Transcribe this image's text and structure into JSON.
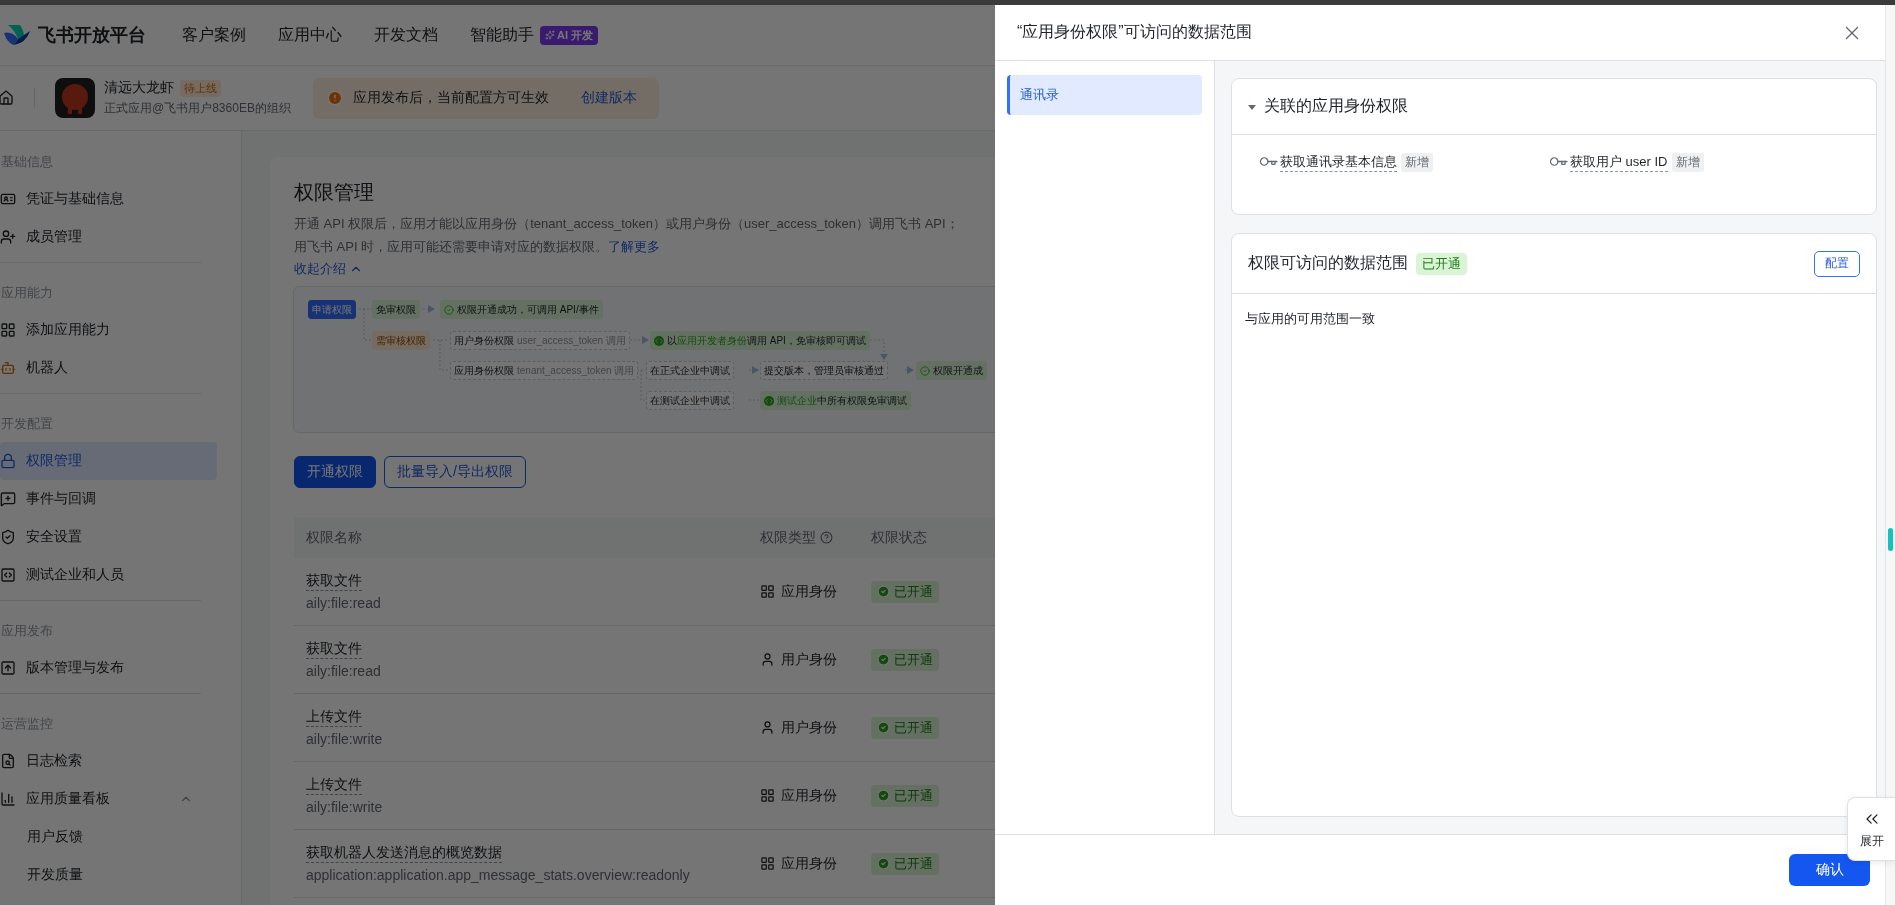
{
  "header": {
    "brand": "飞书开放平台",
    "nav": [
      {
        "label": "客户案例"
      },
      {
        "label": "应用中心"
      },
      {
        "label": "开发文档"
      },
      {
        "label": "智能助手",
        "badge": "AI 开发"
      }
    ]
  },
  "app_bar": {
    "app_name": "清远大龙虾",
    "status_badge": "待上线",
    "org": "正式应用@飞书用户8360EB的组织",
    "notice": {
      "text": "应用发布后，当前配置方可生效",
      "link": "创建版本"
    }
  },
  "sidebar": {
    "groups": [
      {
        "title": "基础信息",
        "items": [
          {
            "label": "凭证与基础信息",
            "selected": false
          },
          {
            "label": "成员管理",
            "selected": false
          }
        ]
      },
      {
        "title": "应用能力",
        "items": [
          {
            "label": "添加应用能力",
            "selected": false
          },
          {
            "label": "机器人",
            "selected": false
          }
        ]
      },
      {
        "title": "开发配置",
        "items": [
          {
            "label": "权限管理",
            "selected": true
          },
          {
            "label": "事件与回调",
            "selected": false
          },
          {
            "label": "安全设置",
            "selected": false
          },
          {
            "label": "测试企业和人员",
            "selected": false
          }
        ]
      },
      {
        "title": "应用发布",
        "items": [
          {
            "label": "版本管理与发布",
            "selected": false
          }
        ]
      },
      {
        "title": "运营监控",
        "items": [
          {
            "label": "日志检索",
            "selected": false
          },
          {
            "label": "应用质量看板",
            "selected": false,
            "expanded": true,
            "children": [
              {
                "label": "用户反馈",
                "selected": false
              },
              {
                "label": "开发质量",
                "selected": false
              }
            ]
          }
        ]
      }
    ]
  },
  "page": {
    "title": "权限管理",
    "intro": [
      "开通 API 权限后，应用才能以应用身份（tenant_access_token）或用户身份（user_access_token）调用飞书 API；",
      "用飞书 API 时，应用可能还需要申请对应的数据权限。"
    ],
    "learn_more": "了解更多",
    "collapse_link": "收起介绍",
    "flow": [
      {
        "kind": "start",
        "parts": [
          {
            "text": "申请权限"
          }
        ]
      },
      {
        "kind": "pass",
        "parts": [
          {
            "text": "免审权限"
          }
        ]
      },
      {
        "kind": "result",
        "parts": [
          {
            "text": "权限开通成功，可调用 API/事件"
          }
        ]
      },
      {
        "kind": "review",
        "parts": [
          {
            "text": "需审核权限"
          }
        ]
      },
      {
        "kind": "step",
        "parts": [
          {
            "text": "用户身份权限"
          },
          {
            "text": "user_access_token 调用",
            "note": true
          }
        ]
      },
      {
        "kind": "debug",
        "parts": [
          {
            "text": "以"
          },
          {
            "text": "应用开发者身份",
            "highlight": true
          },
          {
            "text": "调用 API，免审核即可调试"
          }
        ]
      },
      {
        "kind": "step",
        "parts": [
          {
            "text": "应用身份权限"
          },
          {
            "text": "tenant_access_token 调用",
            "note": true
          }
        ]
      },
      {
        "kind": "step",
        "parts": [
          {
            "text": "在正式企业中调试"
          }
        ]
      },
      {
        "kind": "step",
        "parts": [
          {
            "text": "提交版本，管理员审核通过"
          }
        ]
      },
      {
        "kind": "result",
        "parts": [
          {
            "text": "权限开通成"
          }
        ]
      },
      {
        "kind": "step",
        "parts": [
          {
            "text": "在测试企业中调试"
          }
        ]
      },
      {
        "kind": "debug",
        "parts": [
          {
            "text": "测试企业",
            "highlight": true
          },
          {
            "text": "中所有权限免审调试"
          }
        ]
      }
    ],
    "buttons": [
      {
        "label": "开通权限",
        "kind": "primary"
      },
      {
        "label": "批量导入/导出权限",
        "kind": "outline"
      }
    ],
    "table": {
      "columns": [
        {
          "label": "权限名称"
        },
        {
          "label": "权限类型",
          "help": true
        },
        {
          "label": "权限状态"
        }
      ],
      "rows": [
        {
          "name": "获取文件",
          "scope": "aily:file:read",
          "kind": "app",
          "type": "应用身份",
          "status": "已开通"
        },
        {
          "name": "获取文件",
          "scope": "aily:file:read",
          "kind": "user",
          "type": "用户身份",
          "status": "已开通"
        },
        {
          "name": "上传文件",
          "scope": "aily:file:write",
          "kind": "user",
          "type": "用户身份",
          "status": "已开通"
        },
        {
          "name": "上传文件",
          "scope": "aily:file:write",
          "kind": "app",
          "type": "应用身份",
          "status": "已开通"
        },
        {
          "name": "获取机器人发送消息的概览数据",
          "scope": "application:application.app_message_stats.overview:readonly",
          "kind": "app",
          "type": "应用身份",
          "status": "已开通"
        }
      ]
    }
  },
  "drawer": {
    "title": "“应用身份权限”可访问的数据范围",
    "nav": [
      {
        "label": "通讯录",
        "selected": true
      }
    ],
    "related": {
      "title": "关联的应用身份权限",
      "expanded": true,
      "items": [
        {
          "label": "获取通讯录基本信息",
          "tag": "新增"
        },
        {
          "label": "获取用户 user ID",
          "tag": "新增"
        }
      ]
    },
    "scope": {
      "title": "权限可访问的数据范围",
      "status": "已开通",
      "action": "配置",
      "description": "与应用的可用范围一致"
    },
    "confirm": "确认",
    "expand_tab": "展开"
  }
}
